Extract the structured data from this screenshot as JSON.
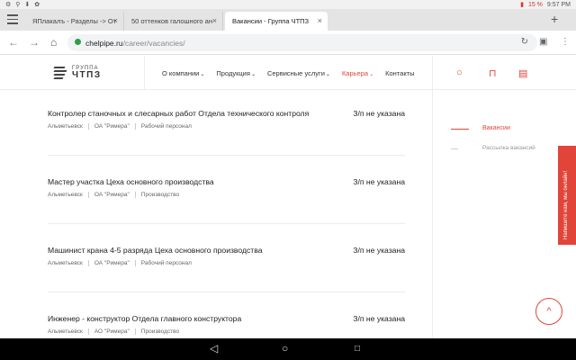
{
  "statusbar": {
    "battery": "15 %",
    "time": "9:57 PM",
    "left_icons": [
      "settings-icon",
      "usb-icon",
      "download-icon",
      "paw-icon"
    ]
  },
  "browser": {
    "tabs": [
      {
        "label": "ЯПлакалъ - Разделы -> От"
      },
      {
        "label": "50 оттенков галошного ан"
      },
      {
        "label": "Вакансии - Группа ЧТПЗ",
        "active": true
      }
    ],
    "new_tab": "+",
    "url_host": "chelpipe.ru",
    "url_path": "/career/vacancies/"
  },
  "site": {
    "logo_top": "ГРУППА",
    "logo_main": "ЧТПЗ",
    "nav": [
      {
        "label": "О компании"
      },
      {
        "label": "Продукция"
      },
      {
        "label": "Сервисные услуги"
      },
      {
        "label": "Карьера",
        "active": true
      },
      {
        "label": "Контакты"
      }
    ],
    "accent": "#e1453a"
  },
  "vacancies": [
    {
      "title": "Контролер станочных и слесарных работ Отдела технического контроля",
      "salary": "З/п не указана",
      "city": "Альметьевск",
      "company": "ОА \"Римера\"",
      "category": "Рабочий персонал"
    },
    {
      "title": "Мастер участка Цеха основного производства",
      "salary": "З/п не указана",
      "city": "Альметьевск",
      "company": "ОА \"Римера\"",
      "category": "Производство"
    },
    {
      "title": "Машинист крана 4-5 разряда Цеха основного производства",
      "salary": "З/п не указана",
      "city": "Альметьевск",
      "company": "ОА \"Римера\"",
      "category": "Рабочий персонал"
    },
    {
      "title": "Инженер - конструктор Отдела главного конструктора",
      "salary": "З/п не указана",
      "city": "Альметьевск",
      "company": "АО \"Римера\"",
      "category": "Производство"
    }
  ],
  "sidebar": {
    "items": [
      {
        "label": "Вакансии",
        "active": true
      },
      {
        "label": "Рассылка вакансий"
      }
    ]
  },
  "chat_tab": "Напишите нам, мы онлайн!",
  "scroll_top": "^"
}
